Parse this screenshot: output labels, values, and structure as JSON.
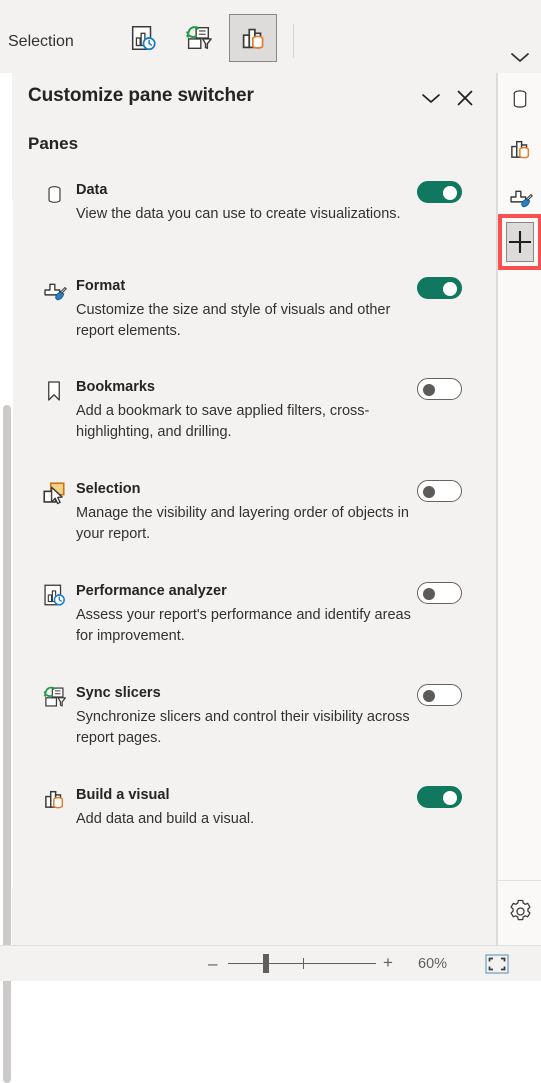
{
  "toolbar": {
    "label": "Selection",
    "buttons": [
      {
        "name": "performance-analyzer",
        "selected": false
      },
      {
        "name": "sync-slicers",
        "selected": false
      },
      {
        "name": "build-a-visual",
        "selected": true
      }
    ],
    "chevron_icon": "chevron-down-icon"
  },
  "pane": {
    "title": "Customize pane switcher",
    "collapse_icon": "chevron-down-icon",
    "close_icon": "close-icon",
    "section_title": "Panes",
    "items": [
      {
        "icon": "data-cylinder-icon",
        "title": "Data",
        "description": "View the data you can use to create visualizations.",
        "toggle": "on"
      },
      {
        "icon": "format-brush-icon",
        "title": "Format",
        "description": "Customize the size and style of visuals and other report elements.",
        "toggle": "on"
      },
      {
        "icon": "bookmark-icon",
        "title": "Bookmarks",
        "description": "Add a bookmark to save applied filters, cross-highlighting, and drilling.",
        "toggle": "off"
      },
      {
        "icon": "selection-cursor-icon",
        "title": "Selection",
        "description": "Manage the visibility and layering order of objects in your report.",
        "toggle": "off"
      },
      {
        "icon": "performance-analyzer-icon",
        "title": "Performance analyzer",
        "description": "Assess your report's performance and identify areas for improvement.",
        "toggle": "off"
      },
      {
        "icon": "sync-slicers-icon",
        "title": "Sync slicers",
        "description": "Synchronize slicers and control their visibility across report pages.",
        "toggle": "off"
      },
      {
        "icon": "build-visual-icon",
        "title": "Build a visual",
        "description": "Add data and build a visual.",
        "toggle": "on"
      }
    ]
  },
  "rail": {
    "buttons": [
      {
        "name": "data-pane-icon"
      },
      {
        "name": "build-visual-pane-icon"
      },
      {
        "name": "format-pane-icon"
      }
    ],
    "add_button": {
      "name": "add-pane-button",
      "glyph": "+",
      "highlight_color": "#f9514f"
    },
    "gear_button": {
      "name": "settings-gear-icon"
    }
  },
  "statusbar": {
    "zoom_out_label": "–",
    "zoom_in_label": "+",
    "zoom_level": "60%",
    "fit_icon": "fit-to-page-icon"
  },
  "colors": {
    "toggle_on": "#10785f",
    "accent_orange": "#e8782a",
    "highlight_red": "#f9514f",
    "pane_background": "#f3f2f1"
  }
}
